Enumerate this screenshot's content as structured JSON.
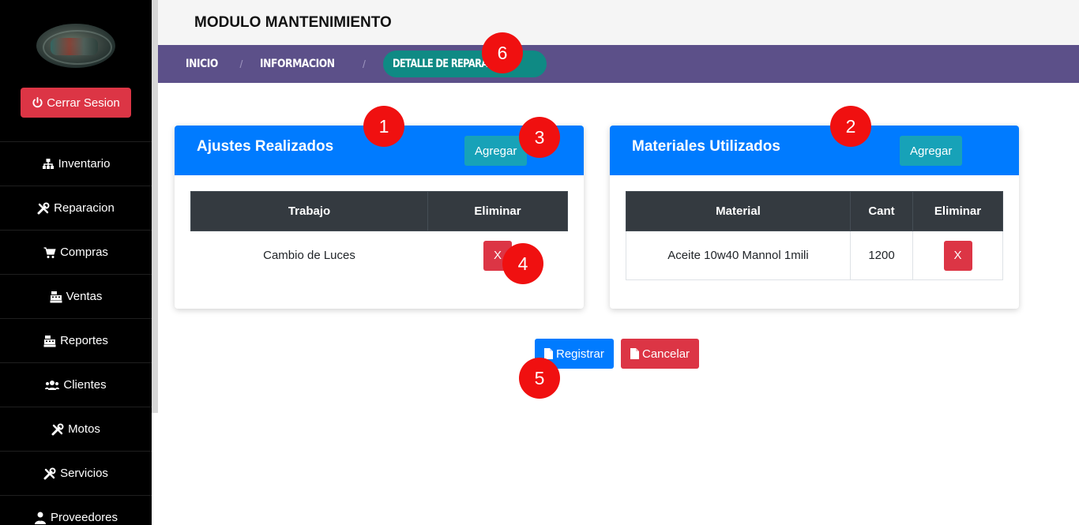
{
  "sidebar": {
    "logout_label": "Cerrar Sesion",
    "items": [
      {
        "label": "Inventario",
        "icon": "sitemap-icon"
      },
      {
        "label": "Reparacion",
        "icon": "tools-icon"
      },
      {
        "label": "Compras",
        "icon": "cart-icon"
      },
      {
        "label": "Ventas",
        "icon": "cash-register-icon"
      },
      {
        "label": "Reportes",
        "icon": "cash-register-icon"
      },
      {
        "label": "Clientes",
        "icon": "users-icon"
      },
      {
        "label": "Motos",
        "icon": "tools-icon"
      },
      {
        "label": "Servicios",
        "icon": "tools-icon"
      },
      {
        "label": "Proveedores",
        "icon": "user-tie-icon"
      }
    ]
  },
  "header": {
    "title": "MODULO MANTENIMIENTO"
  },
  "breadcrumb": {
    "items": [
      "INICIO",
      "INFORMACION"
    ],
    "active": "DETALLE DE REPARACION",
    "separator": "/"
  },
  "ajustes": {
    "title": "Ajustes Realizados",
    "add_label": "Agregar",
    "columns": [
      "Trabajo",
      "Eliminar"
    ],
    "rows": [
      {
        "trabajo": "Cambio de Luces",
        "delete_label": "X"
      }
    ]
  },
  "materiales": {
    "title": "Materiales Utilizados",
    "add_label": "Agregar",
    "columns": [
      "Material",
      "Cant",
      "Eliminar"
    ],
    "rows": [
      {
        "material": "Aceite 10w40 Mannol 1mili",
        "cant": "1200",
        "delete_label": "X"
      }
    ]
  },
  "actions": {
    "register_label": "Registrar",
    "cancel_label": "Cancelar"
  },
  "markers": [
    "1",
    "2",
    "3",
    "4",
    "5",
    "6"
  ],
  "colors": {
    "primary": "#007bff",
    "info": "#17a2b8",
    "danger": "#dc3545",
    "dark": "#343a40",
    "breadcrumb_bg": "#5c5089",
    "breadcrumb_active": "#0f8a84",
    "marker": "#f01010"
  }
}
